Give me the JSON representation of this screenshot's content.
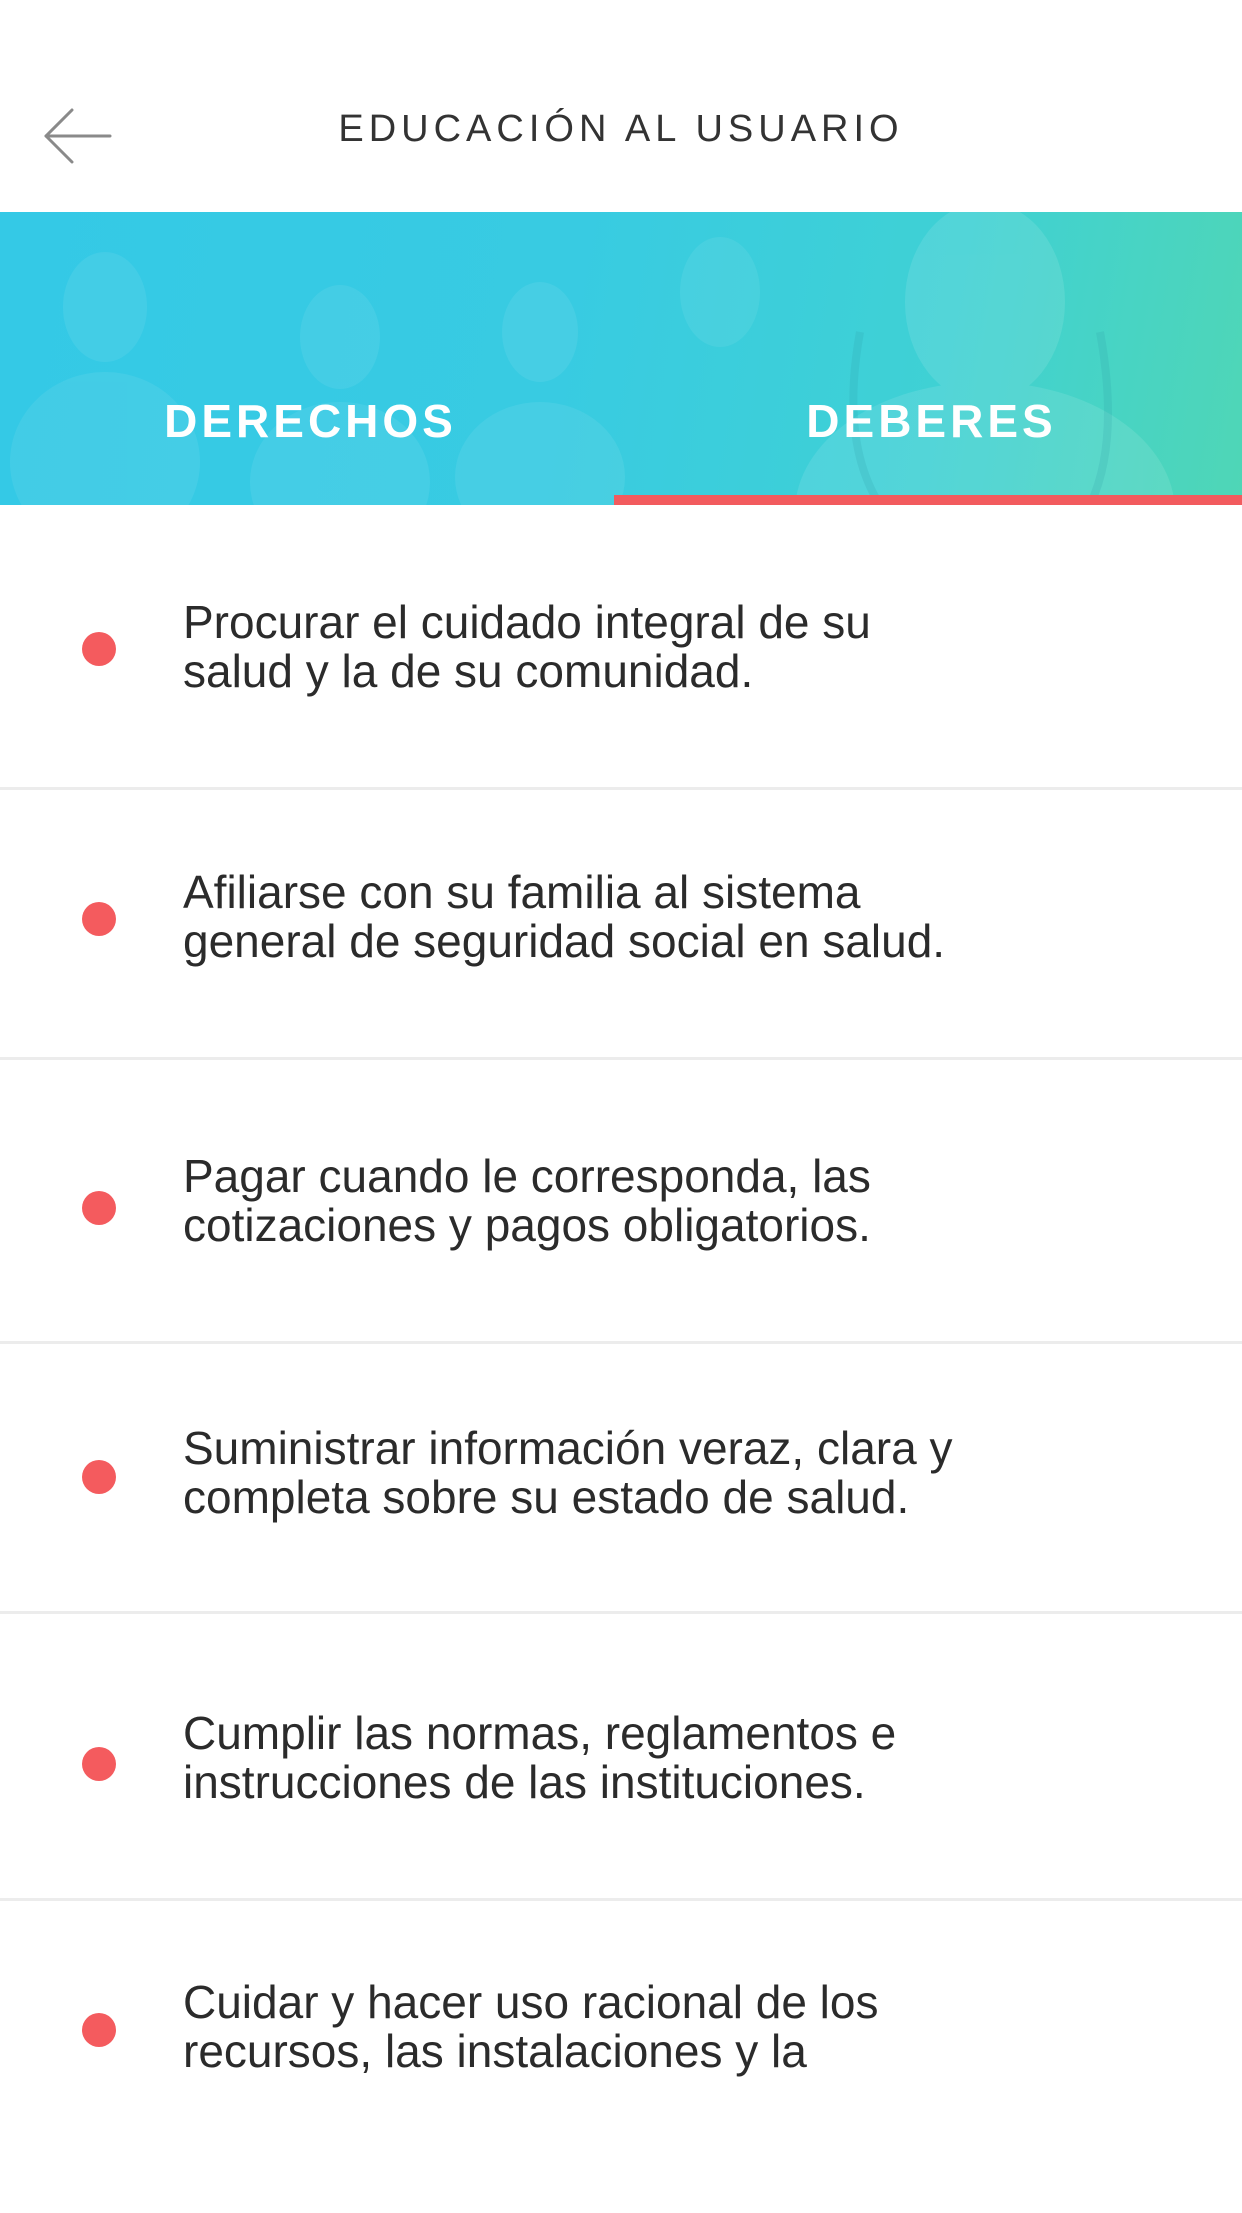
{
  "header": {
    "title": "EDUCACIÓN AL USUARIO",
    "back_icon": "arrow-left-icon"
  },
  "tabs": [
    {
      "label": "DERECHOS",
      "selected": false
    },
    {
      "label": "DEBERES",
      "selected": true
    }
  ],
  "colors": {
    "accent": "#f45b5e",
    "banner_start": "#34c9e6",
    "banner_end": "#4fd6b6",
    "divider": "#ececec"
  },
  "deberes": [
    {
      "text": "Procurar el cuidado integral de su\nsalud y la de su comunidad."
    },
    {
      "text": "Afiliarse con su familia al sistema\ngeneral de seguridad social en salud."
    },
    {
      "text": "Pagar cuando le corresponda, las\ncotizaciones y pagos obligatorios."
    },
    {
      "text": "Suministrar información veraz, clara y\ncompleta sobre su estado de salud."
    },
    {
      "text": " Cumplir las normas, reglamentos e\ninstrucciones de las instituciones."
    },
    {
      "text": "Cuidar y hacer uso racional de los\nrecursos, las instalaciones y la"
    }
  ]
}
